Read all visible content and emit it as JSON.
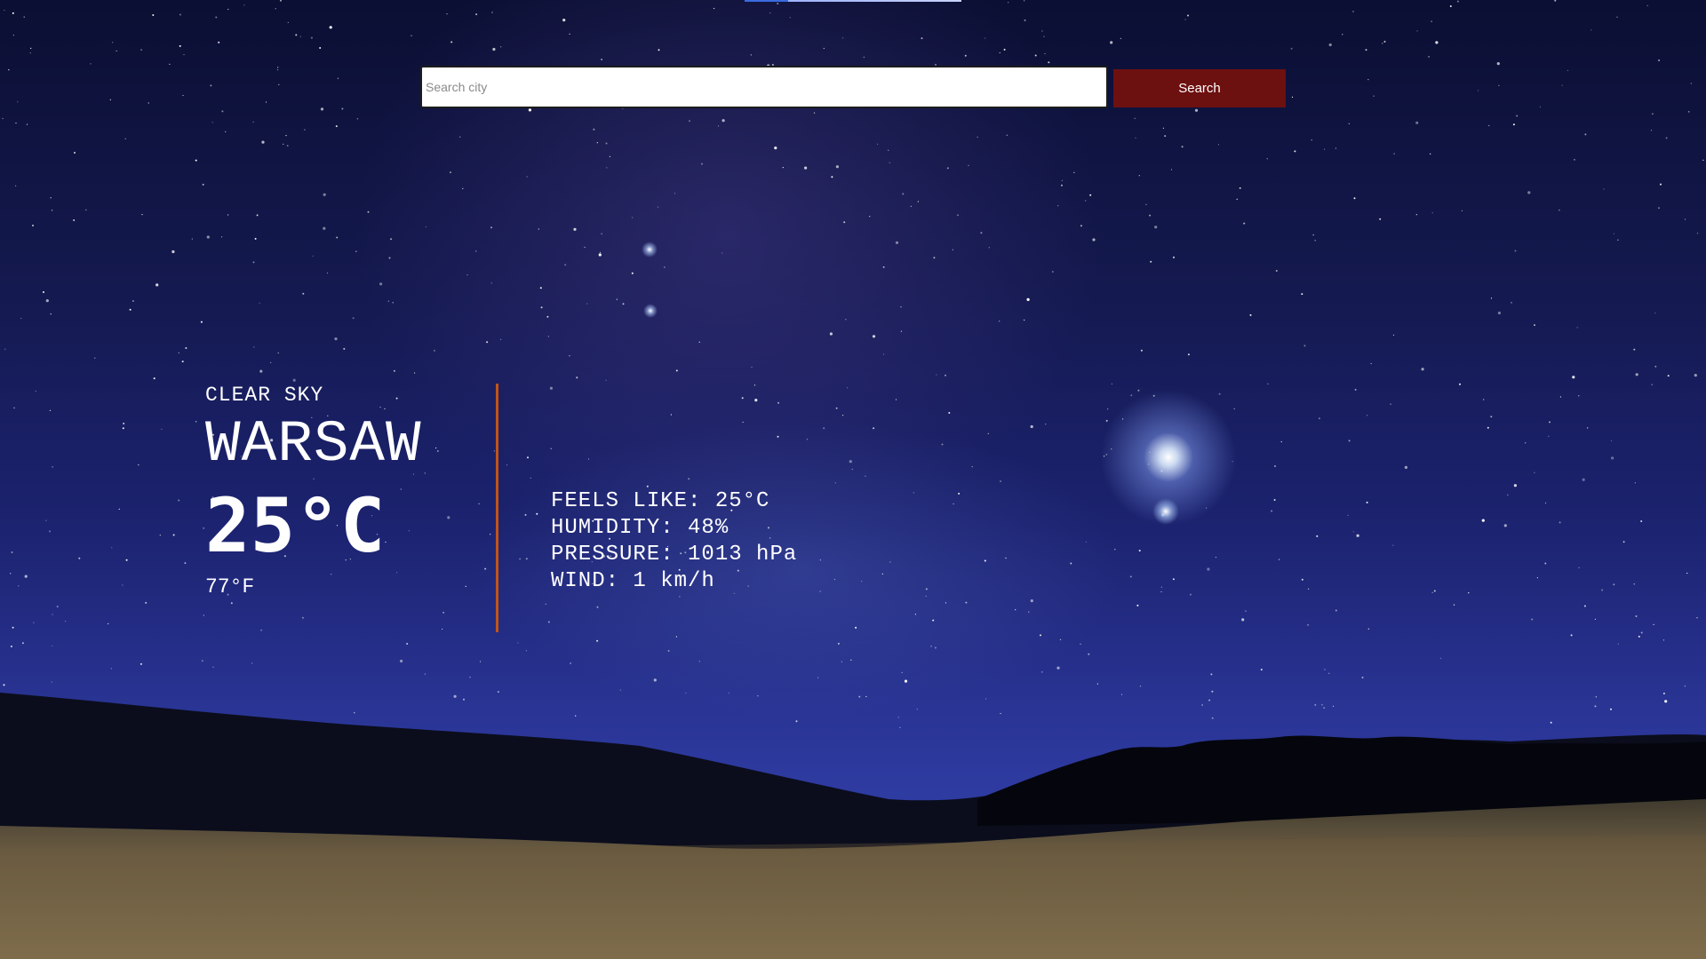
{
  "search": {
    "placeholder": "Search city",
    "value": "",
    "button_label": "Search"
  },
  "weather": {
    "condition": "CLEAR SKY",
    "city": "WARSAW",
    "temp_c": "25°C",
    "temp_f": "77°F"
  },
  "details": [
    {
      "label": "FEELS LIKE:",
      "value": "25°C"
    },
    {
      "label": "HUMIDITY:",
      "value": "48%"
    },
    {
      "label": "PRESSURE:",
      "value": "1013 hPa"
    },
    {
      "label": "WIND:",
      "value": "1 km/h"
    }
  ],
  "colors": {
    "button_bg": "#6d1010",
    "divider": "#c0541a",
    "text": "#ffffff"
  }
}
